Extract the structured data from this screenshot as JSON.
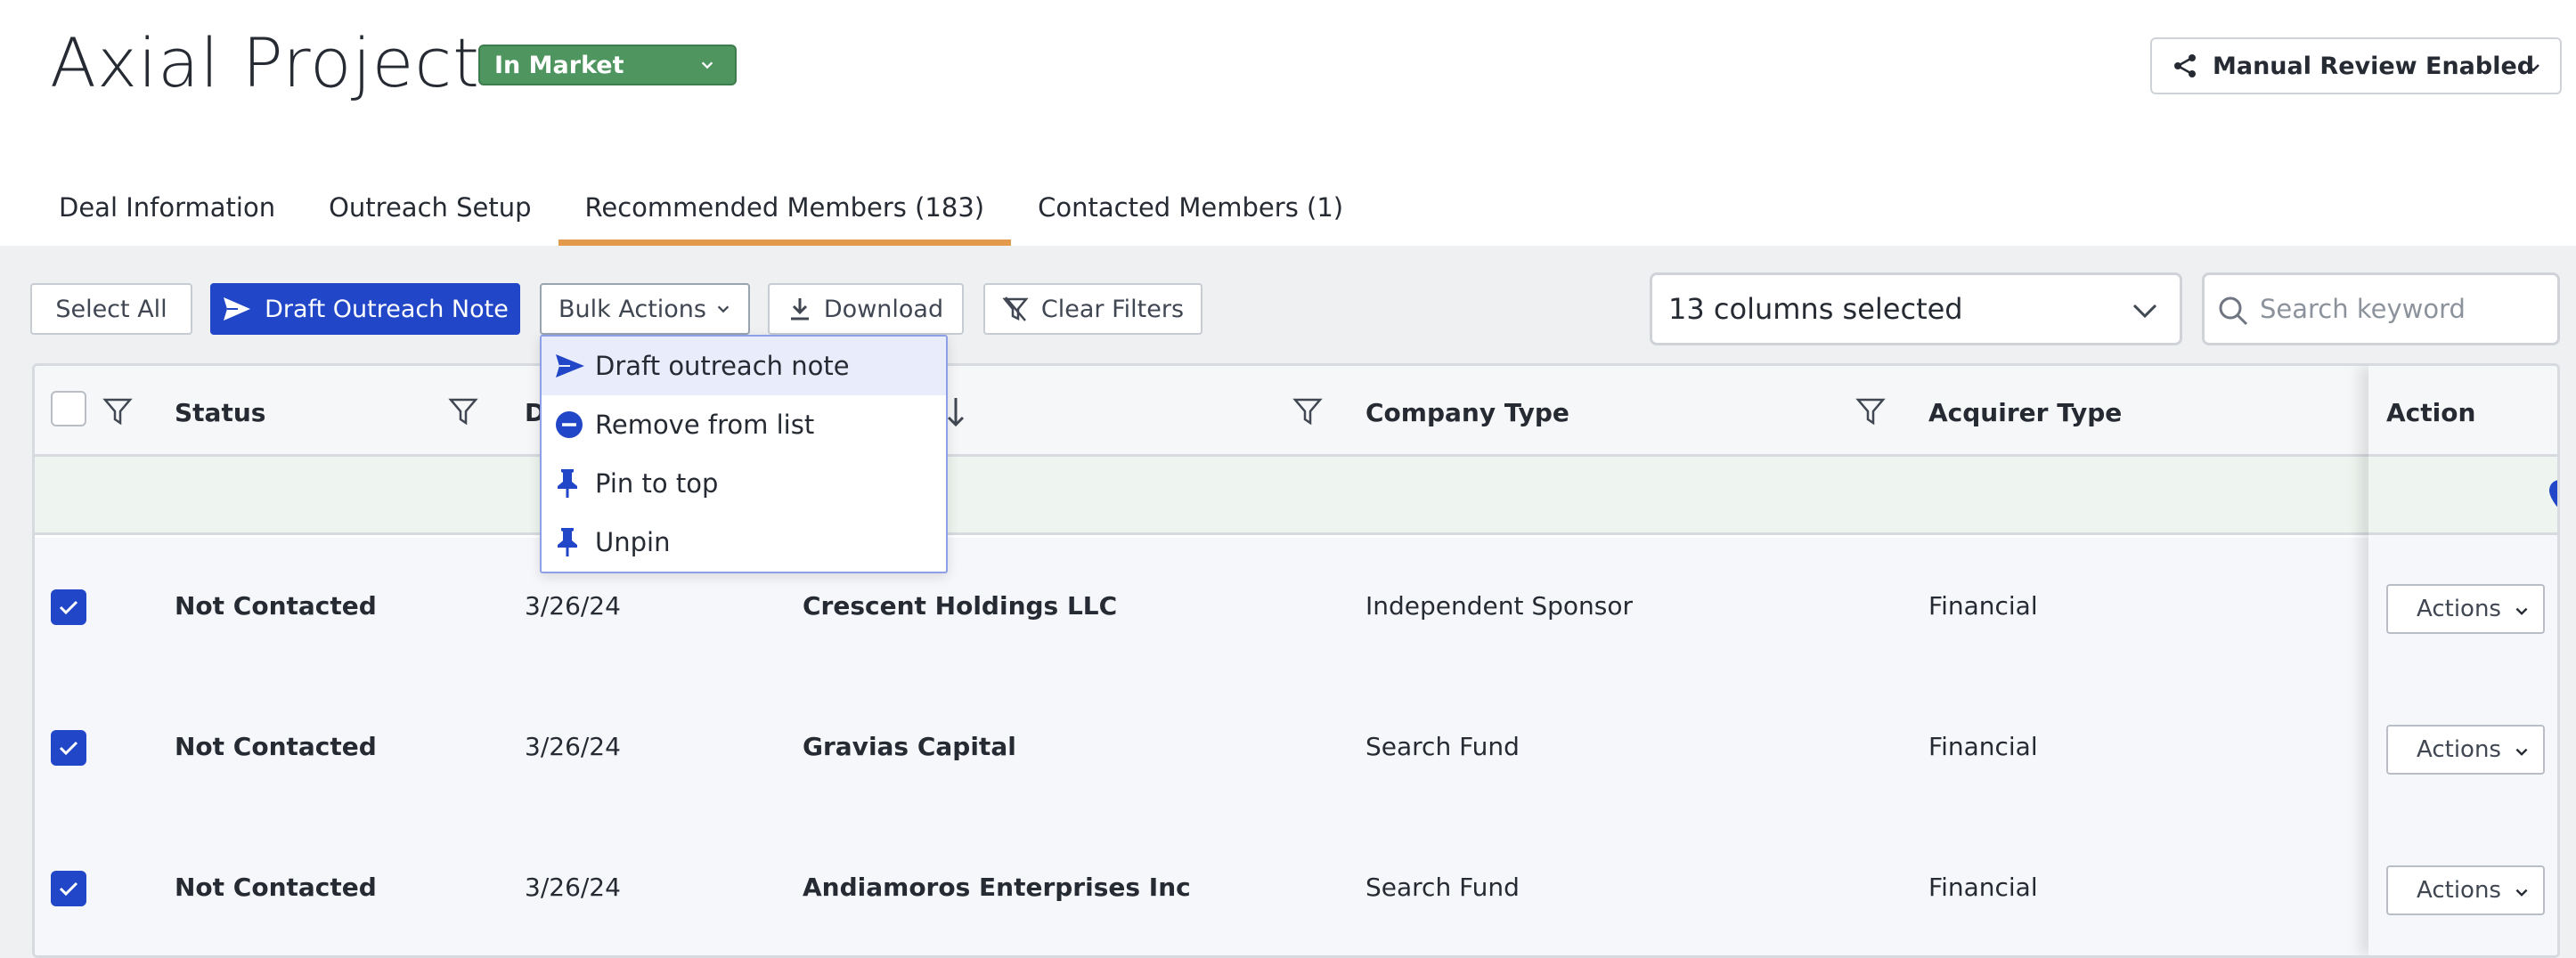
{
  "header": {
    "title": "Axial Project",
    "status": "In Market",
    "review_button": "Manual Review Enabled"
  },
  "tabs": [
    {
      "label": "Deal Information"
    },
    {
      "label": "Outreach Setup"
    },
    {
      "label": "Recommended Members (183)",
      "active": true
    },
    {
      "label": "Contacted Members (1)"
    }
  ],
  "toolbar": {
    "select_all": "Select All",
    "draft_outreach": "Draft Outreach Note",
    "bulk_actions": "Bulk Actions",
    "download": "Download",
    "clear_filters": "Clear Filters",
    "columns_selected": "13 columns selected",
    "search_placeholder": "Search keyword"
  },
  "bulk_menu": {
    "items": [
      {
        "label": "Draft outreach note",
        "icon": "send-icon"
      },
      {
        "label": "Remove from list",
        "icon": "remove-icon"
      },
      {
        "label": "Pin to top",
        "icon": "pin-icon"
      },
      {
        "label": "Unpin",
        "icon": "pin-icon"
      }
    ]
  },
  "table": {
    "columns": {
      "status": "Status",
      "date": "D",
      "company_type": "Company Type",
      "acquirer_type": "Acquirer Type",
      "action": "Action"
    },
    "rows": [
      {
        "status": "Not Contacted",
        "date": "3/26/24",
        "name": "Crescent Holdings LLC",
        "company_type": "Independent Sponsor",
        "acquirer_type": "Financial",
        "action": "Actions"
      },
      {
        "status": "Not Contacted",
        "date": "3/26/24",
        "name": "Gravias Capital",
        "company_type": "Search Fund",
        "acquirer_type": "Financial",
        "action": "Actions"
      },
      {
        "status": "Not Contacted",
        "date": "3/26/24",
        "name": "Andiamoros Enterprises Inc",
        "company_type": "Search Fund",
        "acquirer_type": "Financial",
        "action": "Actions"
      }
    ]
  },
  "colors": {
    "primary": "#2146c7",
    "status_green": "#4f955f",
    "tab_accent": "#e39a4d"
  }
}
